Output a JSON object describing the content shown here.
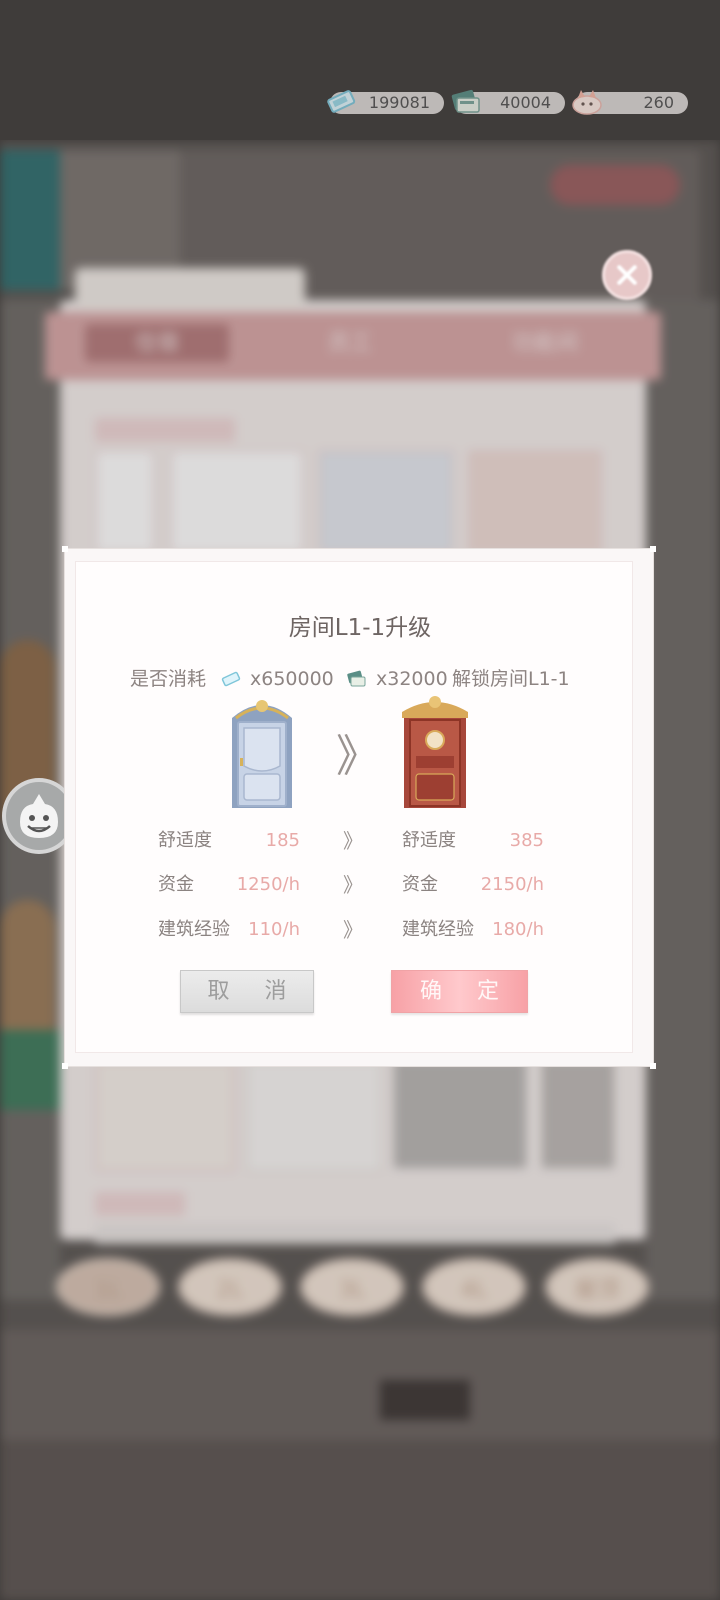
{
  "currency": {
    "diamonds": "199081",
    "books": "40004",
    "cat": "260"
  },
  "dialog": {
    "title": "房间L1-1升级",
    "cost_prefix": "是否消耗",
    "cost_diamonds": "x650000",
    "cost_books": "x32000",
    "cost_suffix": "解锁房间L1-1",
    "stats": [
      {
        "label": "舒适度",
        "current": "185",
        "next_label": "舒适度",
        "next": "385"
      },
      {
        "label": "资金",
        "current": "1250/h",
        "next_label": "资金",
        "next": "2150/h"
      },
      {
        "label": "建筑经验",
        "current": "110/h",
        "next_label": "建筑经验",
        "next": "180/h"
      }
    ],
    "stat_arrow": "》",
    "upgrade_arrow": "》",
    "cancel_label": "取 消",
    "confirm_label": "确 定"
  },
  "colors": {
    "accent_pink": "#f7a1a6",
    "value_pink": "#e8aaa8",
    "panel_header": "#d8a7a7"
  }
}
